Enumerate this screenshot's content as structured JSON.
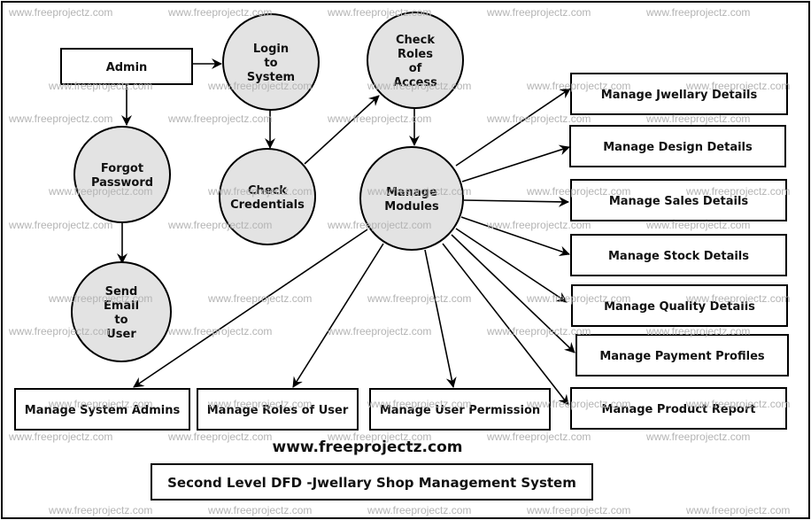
{
  "diagram": {
    "title": "Second Level DFD -Jwellary Shop Management System",
    "site_label": "www.freeprojectz.com",
    "watermark": "www.freeprojectz.com",
    "colors": {
      "process_fill": "#e3e3e3",
      "stroke": "#000000",
      "watermark": "#b4b4b4"
    },
    "entities": [
      {
        "id": "admin",
        "label": "Admin"
      }
    ],
    "processes": [
      {
        "id": "login",
        "lines": [
          "Login",
          "to",
          "System"
        ]
      },
      {
        "id": "check_roles",
        "lines": [
          "Check",
          "Roles",
          "of",
          "Access"
        ]
      },
      {
        "id": "forgot",
        "lines": [
          "Forgot",
          "Password"
        ]
      },
      {
        "id": "check_cred",
        "lines": [
          "Check",
          "Credentials"
        ]
      },
      {
        "id": "manage_modules",
        "lines": [
          "Manage",
          "Modules"
        ]
      },
      {
        "id": "send_email",
        "lines": [
          "Send",
          "Email",
          "to",
          "User"
        ]
      }
    ],
    "modules": [
      {
        "id": "jwellary",
        "label": "Manage Jwellary Details"
      },
      {
        "id": "design",
        "label": "Manage Design Details"
      },
      {
        "id": "sales",
        "label": "Manage Sales Details"
      },
      {
        "id": "stock",
        "label": "Manage Stock Details"
      },
      {
        "id": "quality",
        "label": "Manage Quality Details"
      },
      {
        "id": "payment",
        "label": "Manage Payment Profiles"
      },
      {
        "id": "product_report",
        "label": "Manage Product Report"
      },
      {
        "id": "system_admins",
        "label": "Manage System Admins"
      },
      {
        "id": "roles_user",
        "label": "Manage Roles of User"
      },
      {
        "id": "user_permission",
        "label": "Manage User Permission"
      }
    ],
    "flows": [
      [
        "admin",
        "login"
      ],
      [
        "admin",
        "forgot"
      ],
      [
        "login",
        "check_cred"
      ],
      [
        "check_cred",
        "check_roles"
      ],
      [
        "check_roles",
        "manage_modules"
      ],
      [
        "forgot",
        "send_email"
      ],
      [
        "manage_modules",
        "jwellary"
      ],
      [
        "manage_modules",
        "design"
      ],
      [
        "manage_modules",
        "sales"
      ],
      [
        "manage_modules",
        "stock"
      ],
      [
        "manage_modules",
        "quality"
      ],
      [
        "manage_modules",
        "payment"
      ],
      [
        "manage_modules",
        "product_report"
      ],
      [
        "manage_modules",
        "system_admins"
      ],
      [
        "manage_modules",
        "roles_user"
      ],
      [
        "manage_modules",
        "user_permission"
      ]
    ]
  }
}
